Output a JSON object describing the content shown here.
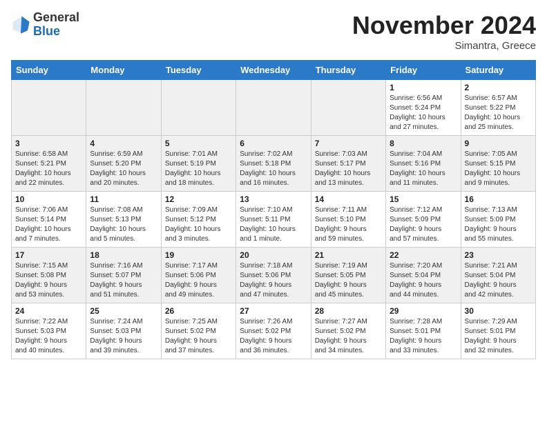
{
  "header": {
    "logo": {
      "line1": "General",
      "line2": "Blue"
    },
    "month": "November 2024",
    "location": "Simantra, Greece"
  },
  "weekdays": [
    "Sunday",
    "Monday",
    "Tuesday",
    "Wednesday",
    "Thursday",
    "Friday",
    "Saturday"
  ],
  "weeks": [
    [
      {
        "day": "",
        "info": ""
      },
      {
        "day": "",
        "info": ""
      },
      {
        "day": "",
        "info": ""
      },
      {
        "day": "",
        "info": ""
      },
      {
        "day": "",
        "info": ""
      },
      {
        "day": "1",
        "info": "Sunrise: 6:56 AM\nSunset: 5:24 PM\nDaylight: 10 hours\nand 27 minutes."
      },
      {
        "day": "2",
        "info": "Sunrise: 6:57 AM\nSunset: 5:22 PM\nDaylight: 10 hours\nand 25 minutes."
      }
    ],
    [
      {
        "day": "3",
        "info": "Sunrise: 6:58 AM\nSunset: 5:21 PM\nDaylight: 10 hours\nand 22 minutes."
      },
      {
        "day": "4",
        "info": "Sunrise: 6:59 AM\nSunset: 5:20 PM\nDaylight: 10 hours\nand 20 minutes."
      },
      {
        "day": "5",
        "info": "Sunrise: 7:01 AM\nSunset: 5:19 PM\nDaylight: 10 hours\nand 18 minutes."
      },
      {
        "day": "6",
        "info": "Sunrise: 7:02 AM\nSunset: 5:18 PM\nDaylight: 10 hours\nand 16 minutes."
      },
      {
        "day": "7",
        "info": "Sunrise: 7:03 AM\nSunset: 5:17 PM\nDaylight: 10 hours\nand 13 minutes."
      },
      {
        "day": "8",
        "info": "Sunrise: 7:04 AM\nSunset: 5:16 PM\nDaylight: 10 hours\nand 11 minutes."
      },
      {
        "day": "9",
        "info": "Sunrise: 7:05 AM\nSunset: 5:15 PM\nDaylight: 10 hours\nand 9 minutes."
      }
    ],
    [
      {
        "day": "10",
        "info": "Sunrise: 7:06 AM\nSunset: 5:14 PM\nDaylight: 10 hours\nand 7 minutes."
      },
      {
        "day": "11",
        "info": "Sunrise: 7:08 AM\nSunset: 5:13 PM\nDaylight: 10 hours\nand 5 minutes."
      },
      {
        "day": "12",
        "info": "Sunrise: 7:09 AM\nSunset: 5:12 PM\nDaylight: 10 hours\nand 3 minutes."
      },
      {
        "day": "13",
        "info": "Sunrise: 7:10 AM\nSunset: 5:11 PM\nDaylight: 10 hours\nand 1 minute."
      },
      {
        "day": "14",
        "info": "Sunrise: 7:11 AM\nSunset: 5:10 PM\nDaylight: 9 hours\nand 59 minutes."
      },
      {
        "day": "15",
        "info": "Sunrise: 7:12 AM\nSunset: 5:09 PM\nDaylight: 9 hours\nand 57 minutes."
      },
      {
        "day": "16",
        "info": "Sunrise: 7:13 AM\nSunset: 5:09 PM\nDaylight: 9 hours\nand 55 minutes."
      }
    ],
    [
      {
        "day": "17",
        "info": "Sunrise: 7:15 AM\nSunset: 5:08 PM\nDaylight: 9 hours\nand 53 minutes."
      },
      {
        "day": "18",
        "info": "Sunrise: 7:16 AM\nSunset: 5:07 PM\nDaylight: 9 hours\nand 51 minutes."
      },
      {
        "day": "19",
        "info": "Sunrise: 7:17 AM\nSunset: 5:06 PM\nDaylight: 9 hours\nand 49 minutes."
      },
      {
        "day": "20",
        "info": "Sunrise: 7:18 AM\nSunset: 5:06 PM\nDaylight: 9 hours\nand 47 minutes."
      },
      {
        "day": "21",
        "info": "Sunrise: 7:19 AM\nSunset: 5:05 PM\nDaylight: 9 hours\nand 45 minutes."
      },
      {
        "day": "22",
        "info": "Sunrise: 7:20 AM\nSunset: 5:04 PM\nDaylight: 9 hours\nand 44 minutes."
      },
      {
        "day": "23",
        "info": "Sunrise: 7:21 AM\nSunset: 5:04 PM\nDaylight: 9 hours\nand 42 minutes."
      }
    ],
    [
      {
        "day": "24",
        "info": "Sunrise: 7:22 AM\nSunset: 5:03 PM\nDaylight: 9 hours\nand 40 minutes."
      },
      {
        "day": "25",
        "info": "Sunrise: 7:24 AM\nSunset: 5:03 PM\nDaylight: 9 hours\nand 39 minutes."
      },
      {
        "day": "26",
        "info": "Sunrise: 7:25 AM\nSunset: 5:02 PM\nDaylight: 9 hours\nand 37 minutes."
      },
      {
        "day": "27",
        "info": "Sunrise: 7:26 AM\nSunset: 5:02 PM\nDaylight: 9 hours\nand 36 minutes."
      },
      {
        "day": "28",
        "info": "Sunrise: 7:27 AM\nSunset: 5:02 PM\nDaylight: 9 hours\nand 34 minutes."
      },
      {
        "day": "29",
        "info": "Sunrise: 7:28 AM\nSunset: 5:01 PM\nDaylight: 9 hours\nand 33 minutes."
      },
      {
        "day": "30",
        "info": "Sunrise: 7:29 AM\nSunset: 5:01 PM\nDaylight: 9 hours\nand 32 minutes."
      }
    ]
  ]
}
